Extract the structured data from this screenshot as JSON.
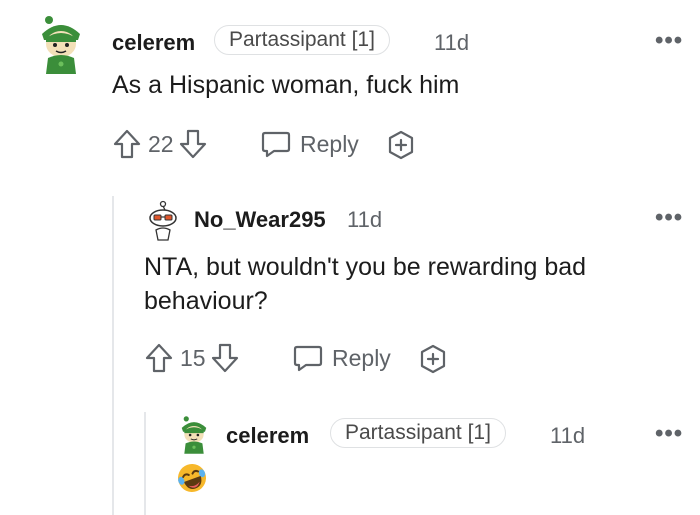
{
  "comments": [
    {
      "username": "celerem",
      "flair": "Partassipant [1]",
      "time": "11d",
      "text": "As a Hispanic woman, fuck him",
      "votes": "22",
      "reply_label": "Reply"
    },
    {
      "username": "No_Wear295",
      "time": "11d",
      "text_line1": "NTA, but wouldn't you be rewarding bad",
      "text_line2": "behaviour?",
      "votes": "15",
      "reply_label": "Reply"
    },
    {
      "username": "celerem",
      "flair": "Partassipant [1]",
      "time": "11d",
      "text": "🤣"
    }
  ],
  "more_label": "•••",
  "colors": {
    "text": "#1c1c1c",
    "muted": "#5f6368",
    "avatar_green": "#3b8e3a",
    "thread_line": "#e5e7ea"
  },
  "icons": [
    "upvote-icon",
    "downvote-icon",
    "reply-icon",
    "award-icon",
    "more-icon",
    "avatar-icon",
    "emoji-icon"
  ]
}
